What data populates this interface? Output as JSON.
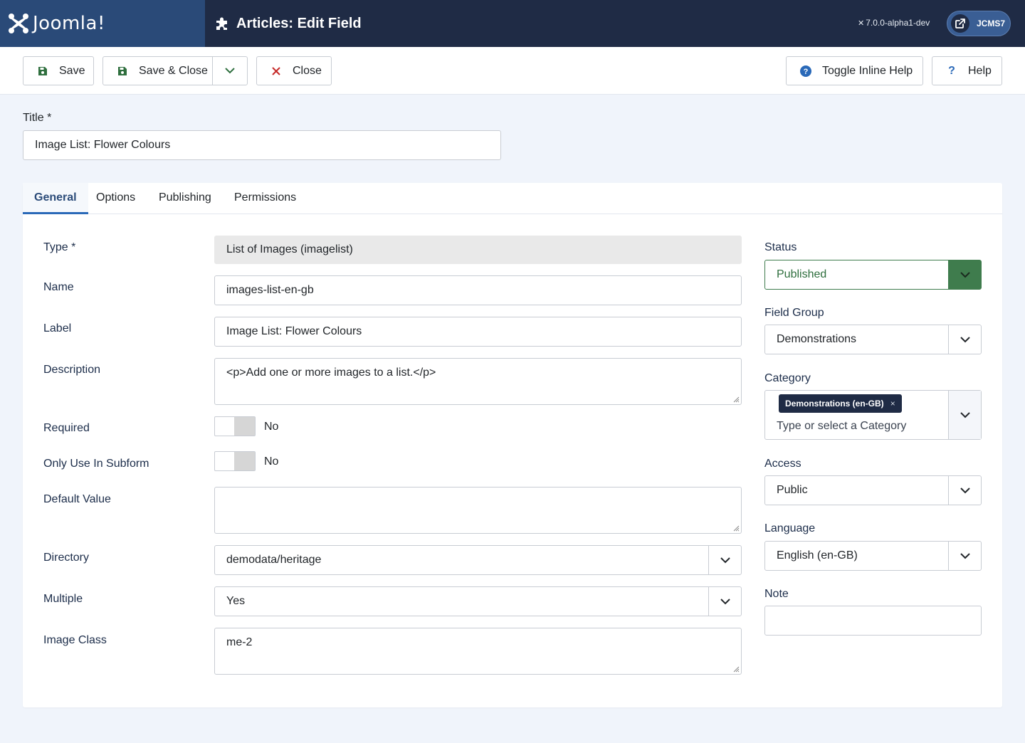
{
  "header": {
    "logo_text": "Joomla!",
    "page_title": "Articles: Edit Field",
    "version": "7.0.0-alpha1-dev",
    "user_label": "JCMS7"
  },
  "toolbar": {
    "save": "Save",
    "save_close": "Save & Close",
    "close": "Close",
    "toggle_inline_help": "Toggle Inline Help",
    "help": "Help"
  },
  "title": {
    "label": "Title *",
    "value": "Image List: Flower Colours"
  },
  "tabs": [
    {
      "label": "General"
    },
    {
      "label": "Options"
    },
    {
      "label": "Publishing"
    },
    {
      "label": "Permissions"
    }
  ],
  "fields": {
    "type": {
      "label": "Type *",
      "value": "List of Images (imagelist)"
    },
    "name": {
      "label": "Name",
      "value": "images-list-en-gb"
    },
    "label": {
      "label": "Label",
      "value": "Image List: Flower Colours"
    },
    "description": {
      "label": "Description",
      "value": "<p>Add one or more images to a list.</p>"
    },
    "required": {
      "label": "Required",
      "value": "No"
    },
    "only_subform": {
      "label": "Only Use In Subform",
      "value": "No"
    },
    "default_value": {
      "label": "Default Value",
      "value": ""
    },
    "directory": {
      "label": "Directory",
      "value": "demodata/heritage"
    },
    "multiple": {
      "label": "Multiple",
      "value": "Yes"
    },
    "image_class": {
      "label": "Image Class",
      "value": "me-2"
    }
  },
  "sidebar": {
    "status": {
      "label": "Status",
      "value": "Published"
    },
    "field_group": {
      "label": "Field Group",
      "value": "Demonstrations"
    },
    "category": {
      "label": "Category",
      "chip": "Demonstrations (en-GB)",
      "chip_remove": "×",
      "placeholder": "Type or select a Category"
    },
    "access": {
      "label": "Access",
      "value": "Public"
    },
    "language": {
      "label": "Language",
      "value": "English (en-GB)"
    },
    "note": {
      "label": "Note",
      "value": ""
    }
  },
  "colors": {
    "header_bg": "#1f2b45",
    "logo_bg": "#2a4a78",
    "status_green": "#3f7c4d",
    "close_red": "#c52827",
    "help_blue": "#2a69b8"
  }
}
